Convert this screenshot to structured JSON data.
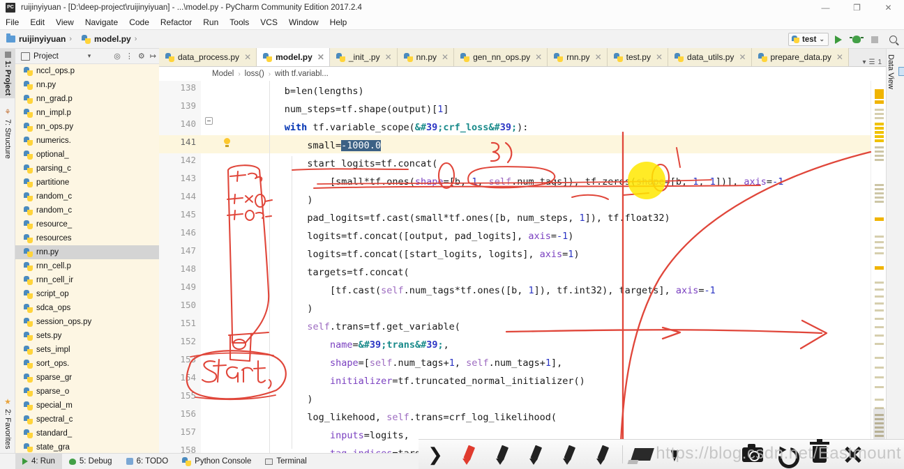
{
  "window": {
    "title": "ruijinyiyuan - [D:\\deep-project\\ruijinyiyuan] - ...\\model.py - PyCharm Community Edition 2017.2.4",
    "logo": "PC",
    "minimize": "—",
    "maximize": "❐",
    "close": "✕"
  },
  "menu": [
    "File",
    "Edit",
    "View",
    "Navigate",
    "Code",
    "Refactor",
    "Run",
    "Tools",
    "VCS",
    "Window",
    "Help"
  ],
  "breadcrumb": {
    "project": "ruijinyiyuan",
    "file": "model.py",
    "sep": "›"
  },
  "run_config": {
    "name": "test",
    "caret": "⌄"
  },
  "left_tool_tabs": [
    {
      "label": "1: Project",
      "selected": true
    },
    {
      "label": "7: Structure",
      "selected": false
    },
    {
      "label": "2: Favorites",
      "selected": false
    }
  ],
  "right_tool_tabs": [
    {
      "label": "Data View",
      "icon": "grid-icon"
    }
  ],
  "project_panel": {
    "title": "Project",
    "caret": "▾"
  },
  "tree_items": [
    {
      "name": "nccl_ops.p",
      "selected": false
    },
    {
      "name": "nn.py",
      "selected": false
    },
    {
      "name": "nn_grad.p",
      "selected": false
    },
    {
      "name": "nn_impl.p",
      "selected": false
    },
    {
      "name": "nn_ops.py",
      "selected": false
    },
    {
      "name": "numerics.",
      "selected": false
    },
    {
      "name": "optional_",
      "selected": false
    },
    {
      "name": "parsing_c",
      "selected": false
    },
    {
      "name": "partitione",
      "selected": false
    },
    {
      "name": "random_c",
      "selected": false
    },
    {
      "name": "random_c",
      "selected": false
    },
    {
      "name": "resource_",
      "selected": false
    },
    {
      "name": "resources",
      "selected": false
    },
    {
      "name": "rnn.py",
      "selected": true
    },
    {
      "name": "rnn_cell.p",
      "selected": false
    },
    {
      "name": "rnn_cell_ir",
      "selected": false
    },
    {
      "name": "script_op",
      "selected": false
    },
    {
      "name": "sdca_ops",
      "selected": false
    },
    {
      "name": "session_ops.py",
      "selected": false
    },
    {
      "name": "sets.py",
      "selected": false
    },
    {
      "name": "sets_impl",
      "selected": false
    },
    {
      "name": "sort_ops.",
      "selected": false
    },
    {
      "name": "sparse_gr",
      "selected": false
    },
    {
      "name": "sparse_o",
      "selected": false
    },
    {
      "name": "special_m",
      "selected": false
    },
    {
      "name": "spectral_c",
      "selected": false
    },
    {
      "name": "standard_",
      "selected": false
    },
    {
      "name": "state_gra",
      "selected": false
    }
  ],
  "editor_tabs": [
    {
      "label": "data_process.py",
      "active": false
    },
    {
      "label": "model.py",
      "active": true
    },
    {
      "label": "_init_.py",
      "active": false
    },
    {
      "label": "nn.py",
      "active": false
    },
    {
      "label": "gen_nn_ops.py",
      "active": false
    },
    {
      "label": "rnn.py",
      "active": false
    },
    {
      "label": "test.py",
      "active": false
    },
    {
      "label": "data_utils.py",
      "active": false
    },
    {
      "label": "prepare_data.py",
      "active": false
    }
  ],
  "tabbar_right": {
    "caret": "▾",
    "count": "1"
  },
  "editor_breadcrumb": [
    "Model",
    "loss()",
    "with tf.variabl..."
  ],
  "code": {
    "first_line": 138,
    "current_line": 141,
    "lines": [
      {
        "n": 138,
        "indent": 3,
        "text": "b=len(lengths)"
      },
      {
        "n": 139,
        "indent": 3,
        "text": "num_steps=tf.shape(output)[1]"
      },
      {
        "n": 140,
        "indent": 3,
        "text": "with tf.variable_scope('crf_loss'):"
      },
      {
        "n": 141,
        "indent": 4,
        "text": "small=-1000.0"
      },
      {
        "n": 142,
        "indent": 4,
        "text": "start_logits=tf.concat("
      },
      {
        "n": 143,
        "indent": 5,
        "text": "[small*tf.ones(shape=[b, 1, self.num_tags]), tf.zeros(shape=[b, 1, 1])], axis=-1"
      },
      {
        "n": 144,
        "indent": 4,
        "text": ")"
      },
      {
        "n": 145,
        "indent": 4,
        "text": "pad_logits=tf.cast(small*tf.ones([b, num_steps, 1]), tf.float32)"
      },
      {
        "n": 146,
        "indent": 4,
        "text": "logits=tf.concat([output, pad_logits], axis=-1)"
      },
      {
        "n": 147,
        "indent": 4,
        "text": "logits=tf.concat([start_logits, logits], axis=1)"
      },
      {
        "n": 148,
        "indent": 4,
        "text": "targets=tf.concat("
      },
      {
        "n": 149,
        "indent": 5,
        "text": "[tf.cast(self.num_tags*tf.ones([b, 1]), tf.int32), targets], axis=-1"
      },
      {
        "n": 150,
        "indent": 4,
        "text": ")"
      },
      {
        "n": 151,
        "indent": 4,
        "text": "self.trans=tf.get_variable("
      },
      {
        "n": 152,
        "indent": 5,
        "text": "name='trans',"
      },
      {
        "n": 153,
        "indent": 5,
        "text": "shape=[self.num_tags+1, self.num_tags+1],"
      },
      {
        "n": 154,
        "indent": 5,
        "text": "initializer=tf.truncated_normal_initializer()"
      },
      {
        "n": 155,
        "indent": 4,
        "text": ")"
      },
      {
        "n": 156,
        "indent": 4,
        "text": "log_likehood, self.trans=crf_log_likelihood("
      },
      {
        "n": 157,
        "indent": 5,
        "text": "inputs=logits,"
      },
      {
        "n": 158,
        "indent": 5,
        "text": "tag_indices=target"
      }
    ],
    "selection": "-1000.0"
  },
  "status_bar": [
    {
      "label": "4: Run",
      "icon": "play-icon",
      "selected": true
    },
    {
      "label": "5: Debug",
      "icon": "bug-icon",
      "selected": false
    },
    {
      "label": "6: TODO",
      "icon": "todo-icon",
      "selected": false
    },
    {
      "label": "Python Console",
      "icon": "python-icon",
      "selected": false
    },
    {
      "label": "Terminal",
      "icon": "terminal-icon",
      "selected": false
    }
  ],
  "annotation_toolbar": {
    "tools": [
      {
        "icon": "chevron-right-icon",
        "active": false
      },
      {
        "icon": "red-pen-icon",
        "active": true
      },
      {
        "icon": "pen-icon",
        "active": false
      },
      {
        "icon": "pen-icon",
        "active": false
      },
      {
        "icon": "pen-icon",
        "active": false
      },
      {
        "icon": "pen-icon",
        "active": false
      },
      {
        "icon": "eraser-icon",
        "active": false
      },
      {
        "icon": "pointer-icon",
        "active": false
      },
      {
        "icon": "camera-icon",
        "active": false
      },
      {
        "icon": "undo-icon",
        "active": false
      },
      {
        "icon": "trash-icon",
        "active": false
      },
      {
        "icon": "close-icon",
        "active": false
      }
    ]
  },
  "watermark": "https://blog.csdn.net/Eastmount",
  "ink_annotations": {
    "start_label": "start",
    "color": "#e0463a",
    "highlight_color": "#ffe800"
  },
  "colors": {
    "keyword": "#0033b3",
    "string": "#1a8b8b",
    "number": "#2b35c4",
    "kwarg": "#7a40c0",
    "self": "#9c6ac0",
    "selection": "#3d6185",
    "current_line": "#fdf6dd",
    "tree_bg": "#fdf6e3"
  }
}
